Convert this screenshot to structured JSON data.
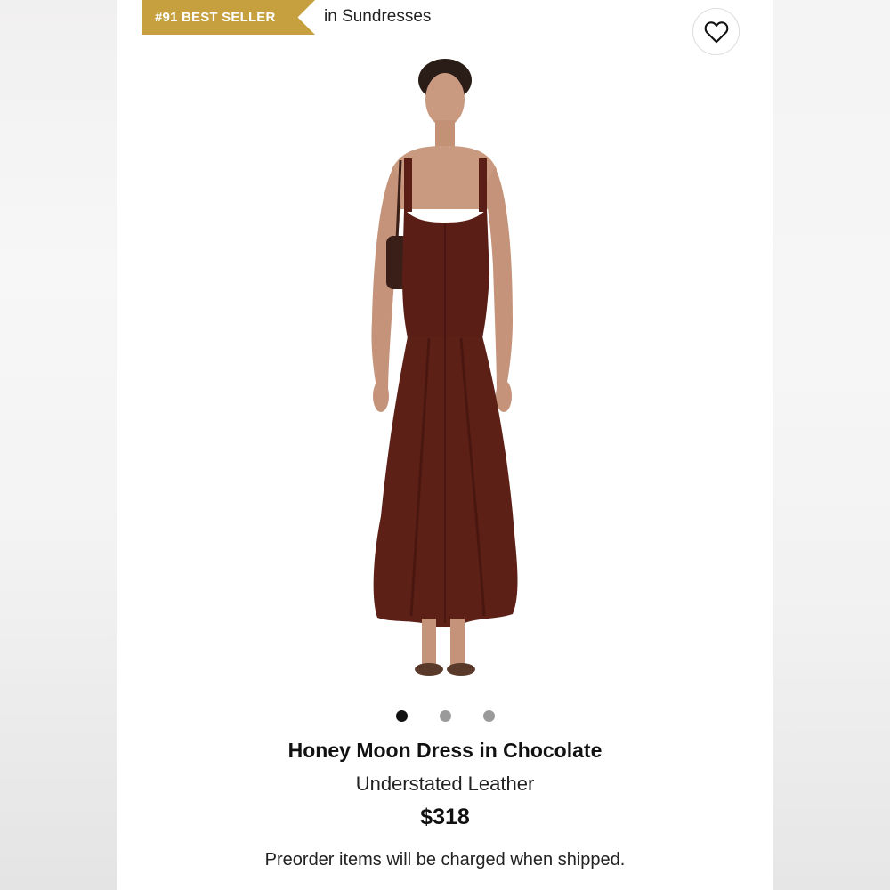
{
  "badge": {
    "label": "#91 BEST SELLER",
    "color": "#c6a03f"
  },
  "category": {
    "text": "in Sundresses"
  },
  "favorite": {
    "icon": "heart-icon"
  },
  "carousel": {
    "total": 3,
    "active_index": 0
  },
  "product": {
    "title": "Honey Moon Dress in Chocolate",
    "brand": "Understated Leather",
    "price": "$318",
    "dress_color": "#5a1e16"
  },
  "notice": {
    "text": "Preorder items will be charged when shipped."
  }
}
